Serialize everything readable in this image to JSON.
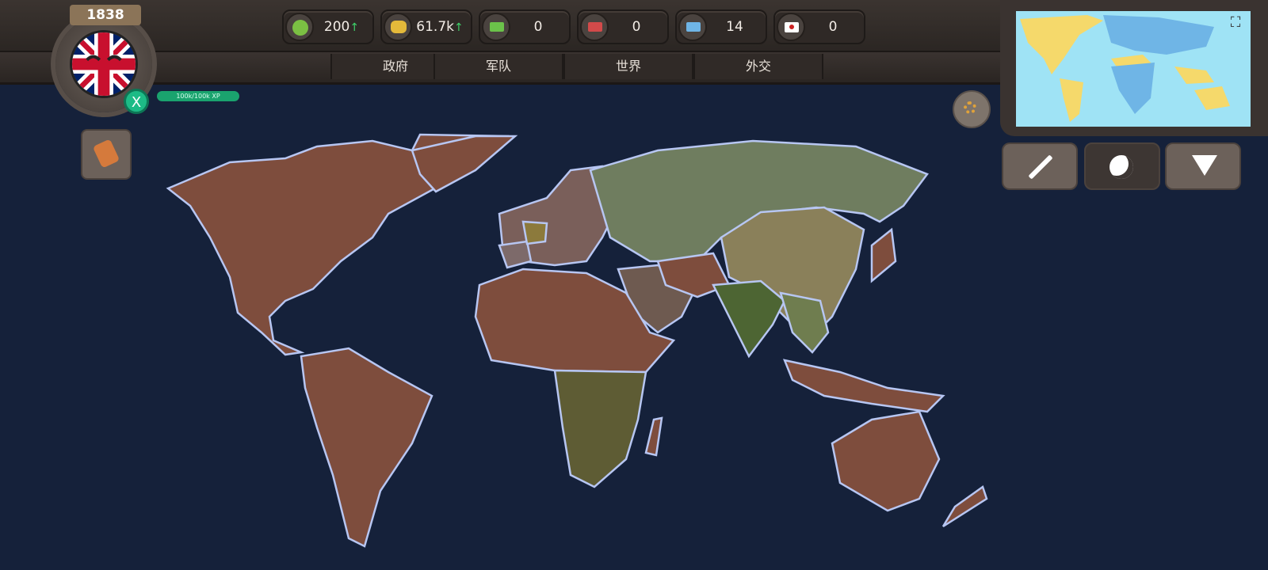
{
  "year": "1838",
  "xp_label": "100k/100k XP",
  "x_button_label": "X",
  "resources": [
    {
      "name": "happiness",
      "value": "200",
      "trend": "↑"
    },
    {
      "name": "gold",
      "value": "61.7k",
      "trend": "↑"
    },
    {
      "name": "green-crown",
      "value": "0",
      "trend": ""
    },
    {
      "name": "red-crown",
      "value": "0",
      "trend": ""
    },
    {
      "name": "blue-crown",
      "value": "14",
      "trend": ""
    },
    {
      "name": "flag-alert",
      "value": "0",
      "trend": ""
    }
  ],
  "tabs": [
    "政府",
    "军队",
    "世界",
    "外交"
  ],
  "colors": {
    "ocean": "#15213a",
    "owned": "#7e4d3d",
    "russia": "#6f7d5f",
    "china": "#8a805a",
    "india": "#4d6533",
    "africa_south": "#5e5c34",
    "xp_bar": "#1aa36e",
    "minimap_sea": "#9fe3f5",
    "minimap_owned": "#f5d96b"
  },
  "icons": [
    "happiness-icon",
    "gold-coins-icon",
    "green-crown-icon",
    "red-crown-icon",
    "blue-crown-icon",
    "flag-icon",
    "scroll-icon",
    "gear-icon",
    "sword-icon",
    "globe-icon",
    "diamond-icon",
    "expand-icon"
  ]
}
